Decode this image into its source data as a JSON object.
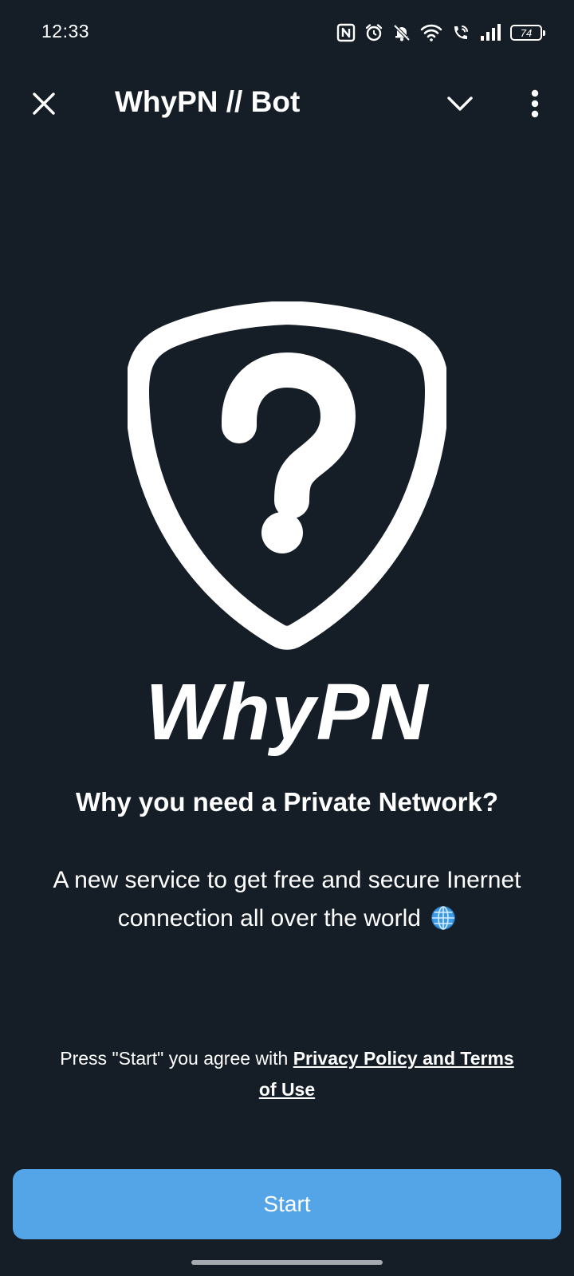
{
  "status_bar": {
    "time": "12:33",
    "battery_level": "74",
    "icons": [
      "nfc-icon",
      "alarm-icon",
      "muted-bell-icon",
      "wifi-icon",
      "wifi-call-icon",
      "signal-icon",
      "battery-icon"
    ]
  },
  "app_bar": {
    "title": "WhyPN // Bot",
    "close_icon": "close-icon",
    "collapse_icon": "chevron-down-icon",
    "menu_icon": "more-vertical-icon"
  },
  "hero": {
    "logo_icon": "shield-question-icon",
    "brand_name": "WhyPN"
  },
  "content": {
    "headline": "Why you need a Private Network?",
    "description": "A new service to get free and secure Inernet connection all over the world",
    "description_emoji": "globe-icon"
  },
  "agreement": {
    "prefix": "Press \"Start\" you agree with ",
    "link_text": "Privacy Policy and Terms of Use"
  },
  "actions": {
    "start_label": "Start"
  },
  "colors": {
    "background": "#151e26",
    "accent": "#53a5e8",
    "text": "#ffffff"
  }
}
